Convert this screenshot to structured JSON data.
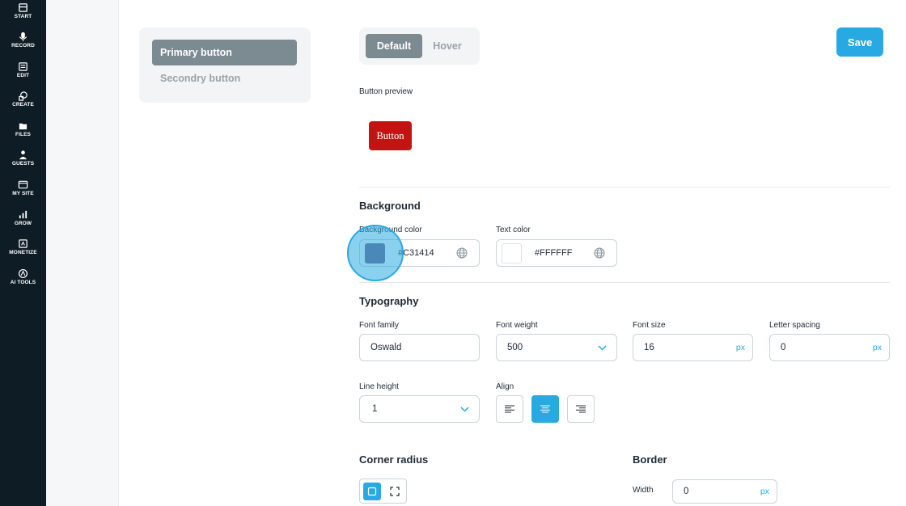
{
  "nav": {
    "items": [
      {
        "label": "START",
        "icon": "home-icon"
      },
      {
        "label": "RECORD",
        "icon": "microphone-icon"
      },
      {
        "label": "EDIT",
        "icon": "edit-icon"
      },
      {
        "label": "CREATE",
        "icon": "create-icon"
      },
      {
        "label": "FILES",
        "icon": "files-icon"
      },
      {
        "label": "GUESTS",
        "icon": "guests-icon"
      },
      {
        "label": "MY SITE",
        "icon": "site-icon"
      },
      {
        "label": "GROW",
        "icon": "chart-icon"
      },
      {
        "label": "MONETIZE",
        "icon": "monetize-icon"
      },
      {
        "label": "AI TOOLS",
        "icon": "ai-icon"
      }
    ]
  },
  "button_types": {
    "primary": "Primary button",
    "secondary": "Secondry button"
  },
  "state_tabs": {
    "default": "Default",
    "hover": "Hover"
  },
  "save_label": "Save",
  "preview": {
    "label": "Button preview",
    "button_text": "Button"
  },
  "background": {
    "title": "Background",
    "bg_color_label": "Background color",
    "bg_color_value": "#C31414",
    "text_color_label": "Text color",
    "text_color_value": "#FFFFFF"
  },
  "typography": {
    "title": "Typography",
    "font_family_label": "Font family",
    "font_family_value": "Oswald",
    "font_weight_label": "Font weight",
    "font_weight_value": "500",
    "font_size_label": "Font size",
    "font_size_value": "16",
    "letter_spacing_label": "Letter spacing",
    "letter_spacing_value": "0",
    "unit": "px",
    "line_height_label": "Line height",
    "line_height_value": "1",
    "align_label": "Align",
    "align_active": "center"
  },
  "corner_radius": {
    "title": "Corner radius"
  },
  "border": {
    "title": "Border",
    "width_label": "Width",
    "width_value": "0",
    "unit": "px"
  },
  "colors": {
    "accent": "#29a9e1",
    "nav_bg": "#0e1c26",
    "preview_button": "#c31414",
    "swatch_shown": "#6f5f87"
  }
}
